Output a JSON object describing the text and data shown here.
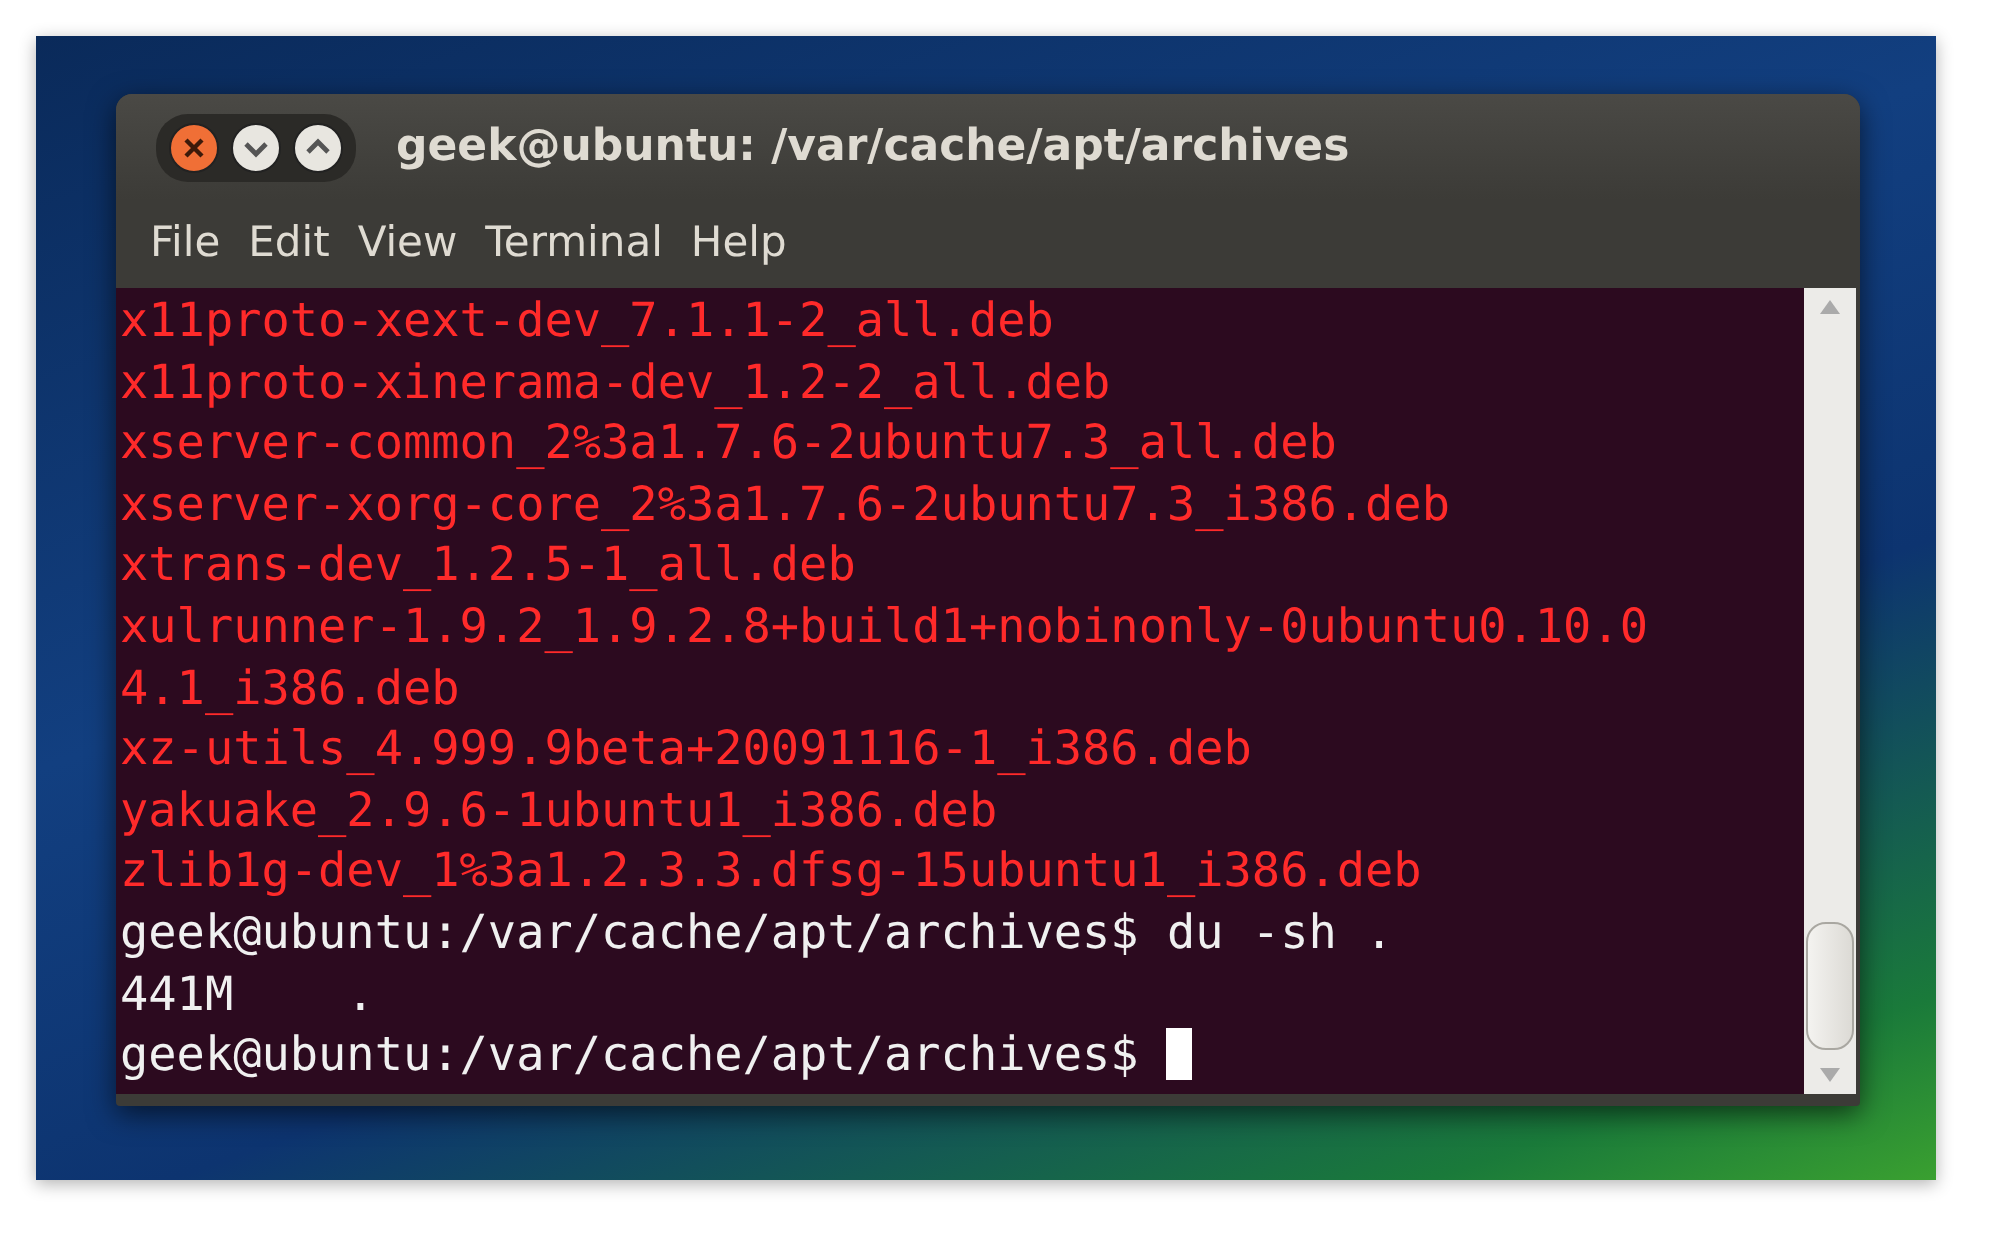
{
  "window": {
    "title": "geek@ubuntu: /var/cache/apt/archives"
  },
  "menu": [
    "File",
    "Edit",
    "View",
    "Terminal",
    "Help"
  ],
  "terminal": {
    "lines": [
      {
        "kind": "file",
        "text": "x11proto-xext-dev_7.1.1-2_all.deb"
      },
      {
        "kind": "file",
        "text": "x11proto-xinerama-dev_1.2-2_all.deb"
      },
      {
        "kind": "file",
        "text": "xserver-common_2%3a1.7.6-2ubuntu7.3_all.deb"
      },
      {
        "kind": "file",
        "text": "xserver-xorg-core_2%3a1.7.6-2ubuntu7.3_i386.deb"
      },
      {
        "kind": "file",
        "text": "xtrans-dev_1.2.5-1_all.deb"
      },
      {
        "kind": "file",
        "text": "xulrunner-1.9.2_1.9.2.8+build1+nobinonly-0ubuntu0.10.0"
      },
      {
        "kind": "file",
        "text": "4.1_i386.deb"
      },
      {
        "kind": "file",
        "text": "xz-utils_4.999.9beta+20091116-1_i386.deb"
      },
      {
        "kind": "file",
        "text": "yakuake_2.9.6-1ubuntu1_i386.deb"
      },
      {
        "kind": "file",
        "text": "zlib1g-dev_1%3a1.2.3.3.dfsg-15ubuntu1_i386.deb"
      },
      {
        "kind": "plain",
        "text": "geek@ubuntu:/var/cache/apt/archives$ du -sh ."
      },
      {
        "kind": "plain",
        "text": "441M    ."
      },
      {
        "kind": "prompt",
        "text": "geek@ubuntu:/var/cache/apt/archives$ "
      }
    ]
  }
}
